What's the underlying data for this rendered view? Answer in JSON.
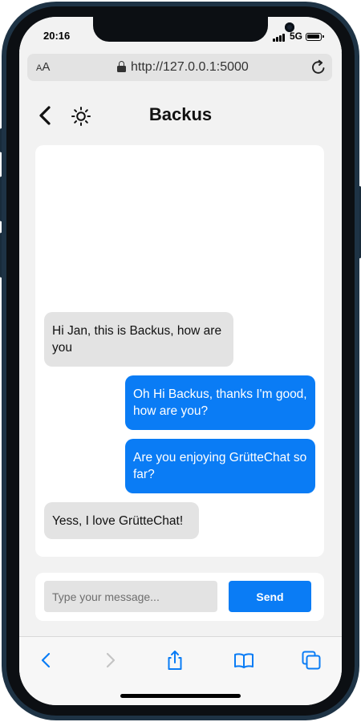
{
  "status_bar": {
    "time": "20:16",
    "network": "5G",
    "icons": [
      "signal-icon",
      "battery-icon"
    ]
  },
  "browser": {
    "text_size_label_small": "A",
    "text_size_label_large": "A",
    "url": "http://127.0.0.1:5000",
    "icons": [
      "lock-icon",
      "reload-icon"
    ]
  },
  "app": {
    "title": "Backus",
    "icons": [
      "back-arrow-icon",
      "settings-sun-icon"
    ]
  },
  "chat": {
    "messages": [
      {
        "sender": "Backus",
        "direction": "incoming",
        "text": "Hi Jan, this is Backus, how are you"
      },
      {
        "sender": "Jan",
        "direction": "outgoing",
        "text": "Oh Hi Backus, thanks I'm good, how are you?"
      },
      {
        "sender": "Jan",
        "direction": "outgoing",
        "text": "Are you enjoying GrütteChat so far?"
      },
      {
        "sender": "Backus",
        "direction": "incoming",
        "text": "Yess, I love GrütteChat!"
      }
    ]
  },
  "composer": {
    "placeholder": "Type your message...",
    "value": "",
    "send_label": "Send"
  },
  "safari_toolbar": {
    "icons": [
      "back-icon",
      "forward-icon",
      "share-icon",
      "bookmarks-icon",
      "tabs-icon"
    ]
  },
  "colors": {
    "accent": "#0a7cf5",
    "incoming_bubble": "#e3e3e3",
    "background": "#f2f2f2",
    "card": "#ffffff",
    "phone_frame": "#1e3345"
  }
}
